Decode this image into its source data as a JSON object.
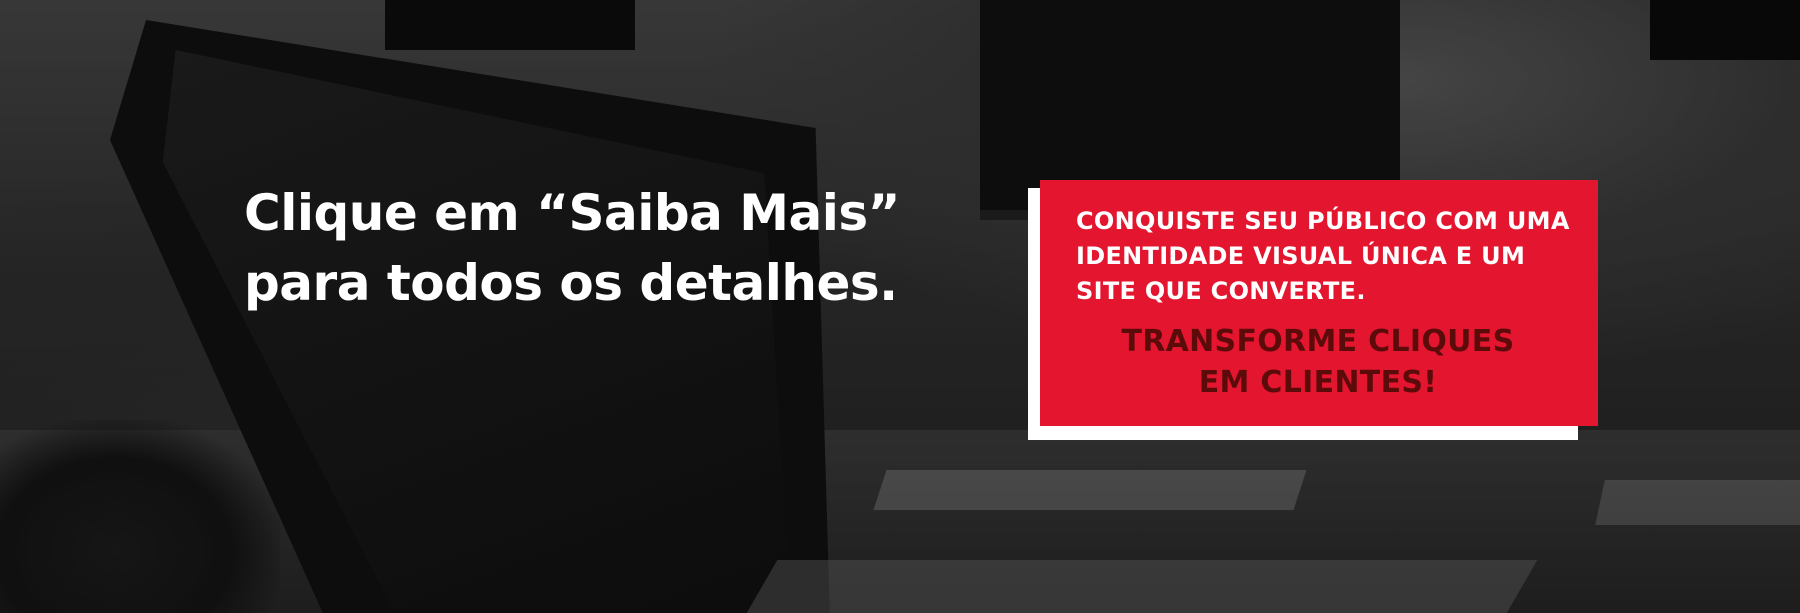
{
  "headline": {
    "line1": "Clique em “Saiba Mais”",
    "line2": "para todos os  detalhes."
  },
  "card": {
    "text_lines": [
      "CONQUISTE SEU PÚBLICO COM UMA",
      "IDENTIDADE VISUAL ÚNICA E UM",
      "SITE QUE CONVERTE."
    ],
    "cta_lines": [
      "TRANSFORME CLIQUES",
      "EM CLIENTES!"
    ]
  },
  "colors": {
    "accent": "#e3152f",
    "cta_text": "#5c0b0b",
    "headline_text": "#ffffff",
    "card_shadow": "#ffffff"
  }
}
